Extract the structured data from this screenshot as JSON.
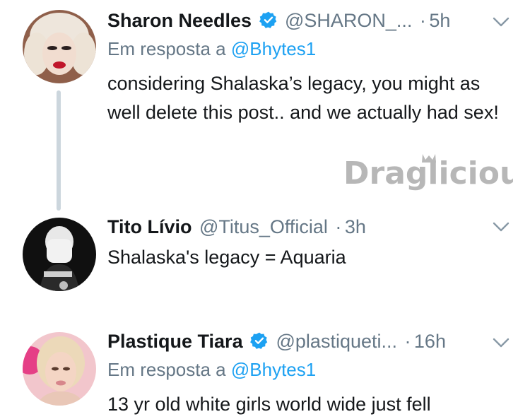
{
  "tweets": [
    {
      "name": "Sharon Needles",
      "verified": true,
      "handle": "@SHARON_...",
      "dot": "·",
      "time": "5h",
      "reply_prefix": "Em resposta a",
      "reply_to": "@Bhytes1",
      "text": "considering Shalaska’s legacy, you might as well delete this post.. and we actually had sex!"
    },
    {
      "name": "Tito Lívio",
      "verified": false,
      "handle": "@Titus_Official",
      "dot": "·",
      "time": "3h",
      "text": "Shalaska's legacy = Aquaria"
    },
    {
      "name": "Plastique Tiara",
      "verified": true,
      "handle": "@plastiqueti...",
      "dot": "·",
      "time": "16h",
      "reply_prefix": "Em resposta a",
      "reply_to": "@Bhytes1",
      "text": "13 yr old white girls world wide just fell"
    }
  ],
  "watermark": {
    "text": "Draglicious"
  },
  "colors": {
    "accent": "#1da1f2",
    "muted": "#657786",
    "thread": "#ccd6dd"
  },
  "icons": {
    "verified": "verified-badge-icon",
    "menu": "chevron-down-icon"
  }
}
